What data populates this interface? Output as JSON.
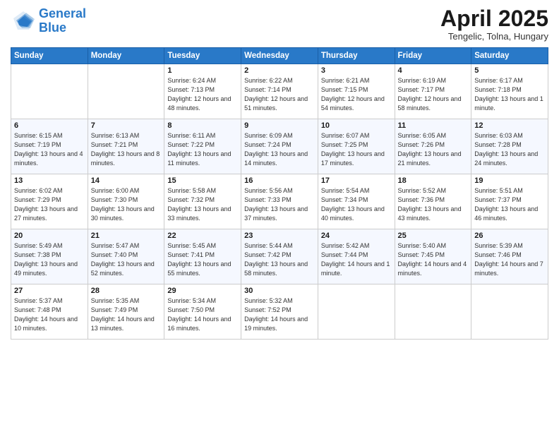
{
  "logo": {
    "line1": "General",
    "line2": "Blue"
  },
  "title": "April 2025",
  "location": "Tengelic, Tolna, Hungary",
  "days_of_week": [
    "Sunday",
    "Monday",
    "Tuesday",
    "Wednesday",
    "Thursday",
    "Friday",
    "Saturday"
  ],
  "weeks": [
    [
      {
        "day": "",
        "sunrise": "",
        "sunset": "",
        "daylight": ""
      },
      {
        "day": "",
        "sunrise": "",
        "sunset": "",
        "daylight": ""
      },
      {
        "day": "1",
        "sunrise": "Sunrise: 6:24 AM",
        "sunset": "Sunset: 7:13 PM",
        "daylight": "Daylight: 12 hours and 48 minutes."
      },
      {
        "day": "2",
        "sunrise": "Sunrise: 6:22 AM",
        "sunset": "Sunset: 7:14 PM",
        "daylight": "Daylight: 12 hours and 51 minutes."
      },
      {
        "day": "3",
        "sunrise": "Sunrise: 6:21 AM",
        "sunset": "Sunset: 7:15 PM",
        "daylight": "Daylight: 12 hours and 54 minutes."
      },
      {
        "day": "4",
        "sunrise": "Sunrise: 6:19 AM",
        "sunset": "Sunset: 7:17 PM",
        "daylight": "Daylight: 12 hours and 58 minutes."
      },
      {
        "day": "5",
        "sunrise": "Sunrise: 6:17 AM",
        "sunset": "Sunset: 7:18 PM",
        "daylight": "Daylight: 13 hours and 1 minute."
      }
    ],
    [
      {
        "day": "6",
        "sunrise": "Sunrise: 6:15 AM",
        "sunset": "Sunset: 7:19 PM",
        "daylight": "Daylight: 13 hours and 4 minutes."
      },
      {
        "day": "7",
        "sunrise": "Sunrise: 6:13 AM",
        "sunset": "Sunset: 7:21 PM",
        "daylight": "Daylight: 13 hours and 8 minutes."
      },
      {
        "day": "8",
        "sunrise": "Sunrise: 6:11 AM",
        "sunset": "Sunset: 7:22 PM",
        "daylight": "Daylight: 13 hours and 11 minutes."
      },
      {
        "day": "9",
        "sunrise": "Sunrise: 6:09 AM",
        "sunset": "Sunset: 7:24 PM",
        "daylight": "Daylight: 13 hours and 14 minutes."
      },
      {
        "day": "10",
        "sunrise": "Sunrise: 6:07 AM",
        "sunset": "Sunset: 7:25 PM",
        "daylight": "Daylight: 13 hours and 17 minutes."
      },
      {
        "day": "11",
        "sunrise": "Sunrise: 6:05 AM",
        "sunset": "Sunset: 7:26 PM",
        "daylight": "Daylight: 13 hours and 21 minutes."
      },
      {
        "day": "12",
        "sunrise": "Sunrise: 6:03 AM",
        "sunset": "Sunset: 7:28 PM",
        "daylight": "Daylight: 13 hours and 24 minutes."
      }
    ],
    [
      {
        "day": "13",
        "sunrise": "Sunrise: 6:02 AM",
        "sunset": "Sunset: 7:29 PM",
        "daylight": "Daylight: 13 hours and 27 minutes."
      },
      {
        "day": "14",
        "sunrise": "Sunrise: 6:00 AM",
        "sunset": "Sunset: 7:30 PM",
        "daylight": "Daylight: 13 hours and 30 minutes."
      },
      {
        "day": "15",
        "sunrise": "Sunrise: 5:58 AM",
        "sunset": "Sunset: 7:32 PM",
        "daylight": "Daylight: 13 hours and 33 minutes."
      },
      {
        "day": "16",
        "sunrise": "Sunrise: 5:56 AM",
        "sunset": "Sunset: 7:33 PM",
        "daylight": "Daylight: 13 hours and 37 minutes."
      },
      {
        "day": "17",
        "sunrise": "Sunrise: 5:54 AM",
        "sunset": "Sunset: 7:34 PM",
        "daylight": "Daylight: 13 hours and 40 minutes."
      },
      {
        "day": "18",
        "sunrise": "Sunrise: 5:52 AM",
        "sunset": "Sunset: 7:36 PM",
        "daylight": "Daylight: 13 hours and 43 minutes."
      },
      {
        "day": "19",
        "sunrise": "Sunrise: 5:51 AM",
        "sunset": "Sunset: 7:37 PM",
        "daylight": "Daylight: 13 hours and 46 minutes."
      }
    ],
    [
      {
        "day": "20",
        "sunrise": "Sunrise: 5:49 AM",
        "sunset": "Sunset: 7:38 PM",
        "daylight": "Daylight: 13 hours and 49 minutes."
      },
      {
        "day": "21",
        "sunrise": "Sunrise: 5:47 AM",
        "sunset": "Sunset: 7:40 PM",
        "daylight": "Daylight: 13 hours and 52 minutes."
      },
      {
        "day": "22",
        "sunrise": "Sunrise: 5:45 AM",
        "sunset": "Sunset: 7:41 PM",
        "daylight": "Daylight: 13 hours and 55 minutes."
      },
      {
        "day": "23",
        "sunrise": "Sunrise: 5:44 AM",
        "sunset": "Sunset: 7:42 PM",
        "daylight": "Daylight: 13 hours and 58 minutes."
      },
      {
        "day": "24",
        "sunrise": "Sunrise: 5:42 AM",
        "sunset": "Sunset: 7:44 PM",
        "daylight": "Daylight: 14 hours and 1 minute."
      },
      {
        "day": "25",
        "sunrise": "Sunrise: 5:40 AM",
        "sunset": "Sunset: 7:45 PM",
        "daylight": "Daylight: 14 hours and 4 minutes."
      },
      {
        "day": "26",
        "sunrise": "Sunrise: 5:39 AM",
        "sunset": "Sunset: 7:46 PM",
        "daylight": "Daylight: 14 hours and 7 minutes."
      }
    ],
    [
      {
        "day": "27",
        "sunrise": "Sunrise: 5:37 AM",
        "sunset": "Sunset: 7:48 PM",
        "daylight": "Daylight: 14 hours and 10 minutes."
      },
      {
        "day": "28",
        "sunrise": "Sunrise: 5:35 AM",
        "sunset": "Sunset: 7:49 PM",
        "daylight": "Daylight: 14 hours and 13 minutes."
      },
      {
        "day": "29",
        "sunrise": "Sunrise: 5:34 AM",
        "sunset": "Sunset: 7:50 PM",
        "daylight": "Daylight: 14 hours and 16 minutes."
      },
      {
        "day": "30",
        "sunrise": "Sunrise: 5:32 AM",
        "sunset": "Sunset: 7:52 PM",
        "daylight": "Daylight: 14 hours and 19 minutes."
      },
      {
        "day": "",
        "sunrise": "",
        "sunset": "",
        "daylight": ""
      },
      {
        "day": "",
        "sunrise": "",
        "sunset": "",
        "daylight": ""
      },
      {
        "day": "",
        "sunrise": "",
        "sunset": "",
        "daylight": ""
      }
    ]
  ]
}
